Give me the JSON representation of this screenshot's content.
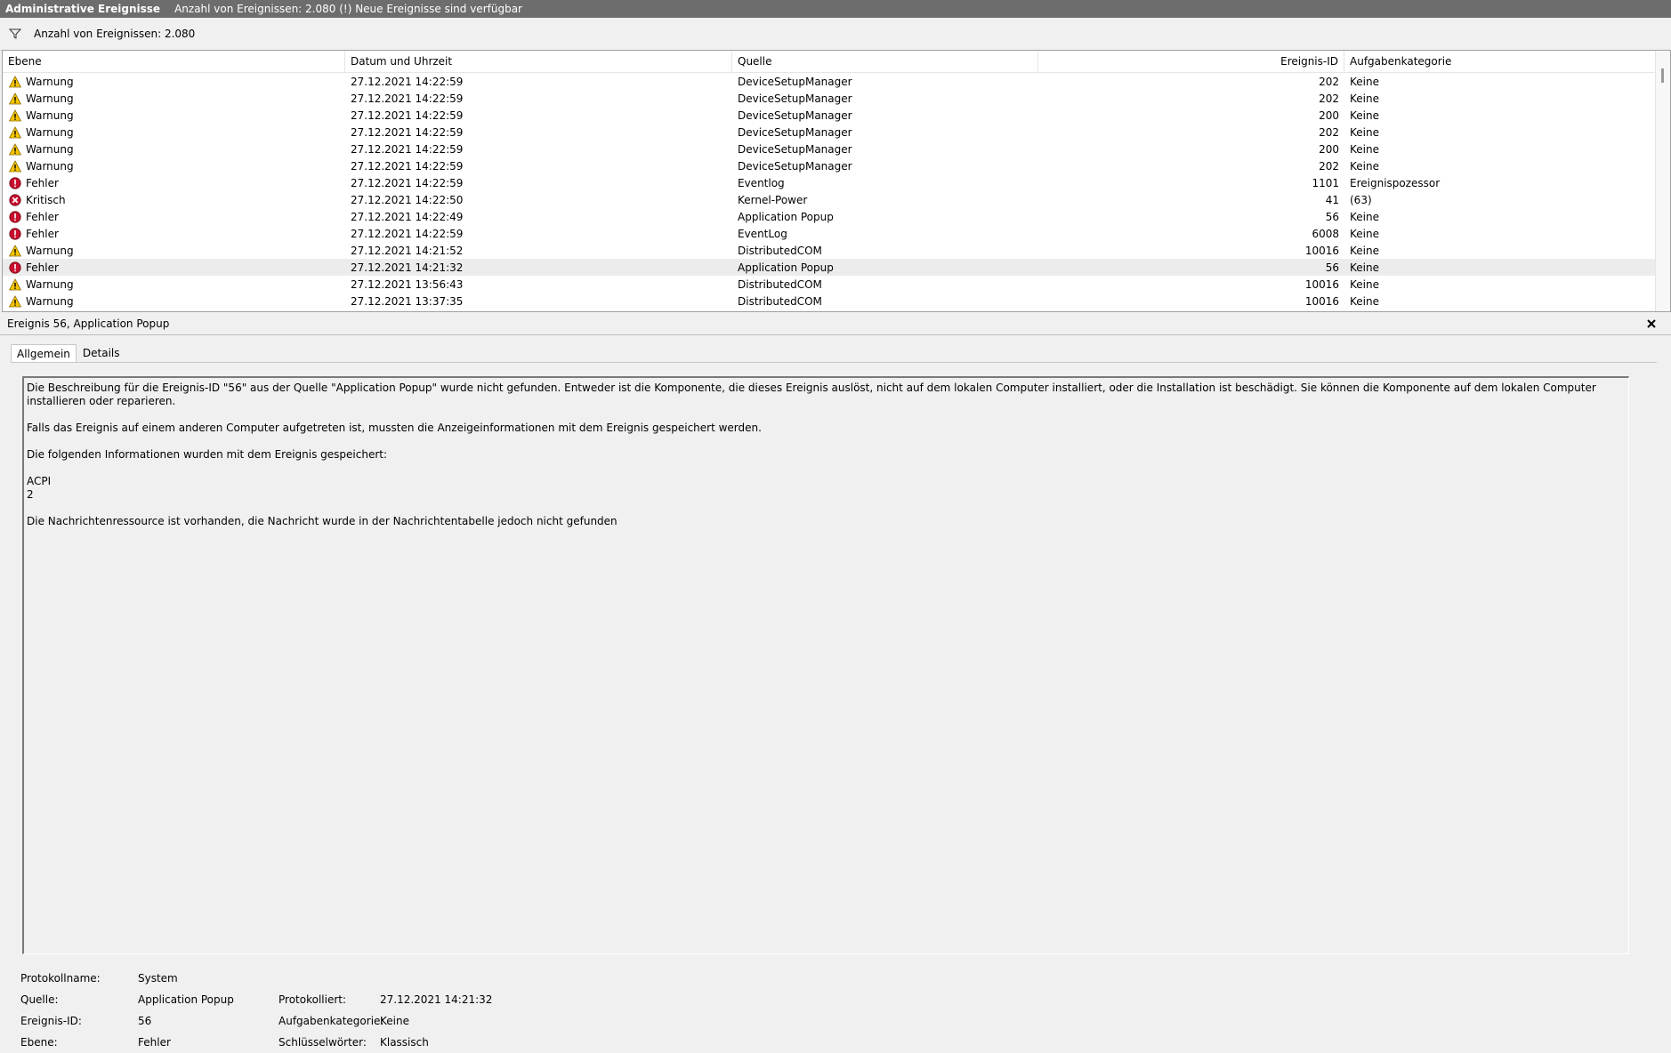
{
  "title_bar": {
    "title": "Administrative Ereignisse",
    "info": "Anzahl von Ereignissen: 2.080 (!) Neue Ereignisse sind verfügbar"
  },
  "filter_bar": {
    "count_text": "Anzahl von Ereignissen: 2.080"
  },
  "columns": {
    "level": "Ebene",
    "date": "Datum und Uhrzeit",
    "source": "Quelle",
    "event_id": "Ereignis-ID",
    "category": "Aufgabenkategorie"
  },
  "events": [
    {
      "level": "Warnung",
      "icon": "warning-icon",
      "date": "27.12.2021 14:22:59",
      "source": "DeviceSetupManager",
      "id": "202",
      "category": "Keine"
    },
    {
      "level": "Warnung",
      "icon": "warning-icon",
      "date": "27.12.2021 14:22:59",
      "source": "DeviceSetupManager",
      "id": "202",
      "category": "Keine"
    },
    {
      "level": "Warnung",
      "icon": "warning-icon",
      "date": "27.12.2021 14:22:59",
      "source": "DeviceSetupManager",
      "id": "200",
      "category": "Keine"
    },
    {
      "level": "Warnung",
      "icon": "warning-icon",
      "date": "27.12.2021 14:22:59",
      "source": "DeviceSetupManager",
      "id": "202",
      "category": "Keine"
    },
    {
      "level": "Warnung",
      "icon": "warning-icon",
      "date": "27.12.2021 14:22:59",
      "source": "DeviceSetupManager",
      "id": "200",
      "category": "Keine"
    },
    {
      "level": "Warnung",
      "icon": "warning-icon",
      "date": "27.12.2021 14:22:59",
      "source": "DeviceSetupManager",
      "id": "202",
      "category": "Keine"
    },
    {
      "level": "Fehler",
      "icon": "error-icon",
      "date": "27.12.2021 14:22:59",
      "source": "Eventlog",
      "id": "1101",
      "category": "Ereignispozessor"
    },
    {
      "level": "Kritisch",
      "icon": "critical-icon",
      "date": "27.12.2021 14:22:50",
      "source": "Kernel-Power",
      "id": "41",
      "category": "(63)"
    },
    {
      "level": "Fehler",
      "icon": "error-icon",
      "date": "27.12.2021 14:22:49",
      "source": "Application Popup",
      "id": "56",
      "category": "Keine"
    },
    {
      "level": "Fehler",
      "icon": "error-icon",
      "date": "27.12.2021 14:22:59",
      "source": "EventLog",
      "id": "6008",
      "category": "Keine"
    },
    {
      "level": "Warnung",
      "icon": "warning-icon",
      "date": "27.12.2021 14:21:52",
      "source": "DistributedCOM",
      "id": "10016",
      "category": "Keine"
    },
    {
      "level": "Fehler",
      "icon": "error-icon",
      "date": "27.12.2021 14:21:32",
      "source": "Application Popup",
      "id": "56",
      "category": "Keine",
      "selected": true
    },
    {
      "level": "Warnung",
      "icon": "warning-icon",
      "date": "27.12.2021 13:56:43",
      "source": "DistributedCOM",
      "id": "10016",
      "category": "Keine"
    },
    {
      "level": "Warnung",
      "icon": "warning-icon",
      "date": "27.12.2021 13:37:35",
      "source": "DistributedCOM",
      "id": "10016",
      "category": "Keine"
    }
  ],
  "detail": {
    "title": "Ereignis 56, Application Popup",
    "tabs": [
      "Allgemein",
      "Details"
    ],
    "description": [
      "Die Beschreibung für die Ereignis-ID \"56\" aus der Quelle \"Application Popup\" wurde nicht gefunden. Entweder ist die Komponente, die dieses Ereignis auslöst, nicht auf dem lokalen Computer installiert, oder die Installation ist beschädigt. Sie können die Komponente auf dem lokalen Computer installieren oder reparieren.",
      "Falls das Ereignis auf einem anderen Computer aufgetreten ist, mussten die Anzeigeinformationen mit dem Ereignis gespeichert werden.",
      "Die folgenden Informationen wurden mit dem Ereignis gespeichert:",
      "ACPI",
      "2",
      "Die Nachrichtenressource ist vorhanden, die Nachricht wurde in der Nachrichtentabelle jedoch nicht gefunden"
    ],
    "properties": {
      "log_name_label": "Protokollname:",
      "log_name": "System",
      "source_label": "Quelle:",
      "source": "Application Popup",
      "logged_label": "Protokolliert:",
      "logged": "27.12.2021 14:21:32",
      "event_id_label": "Ereignis-ID:",
      "event_id": "56",
      "category_label": "Aufgabenkategorie:",
      "category": "Keine",
      "level_label": "Ebene:",
      "level": "Fehler",
      "keywords_label": "Schlüsselwörter:",
      "keywords": "Klassisch"
    }
  },
  "colors": {
    "title_bar": "#6d6d6d",
    "selected_row": "#ececec",
    "warning": "#f5c400",
    "error": "#c8102e",
    "critical": "#c8102e"
  }
}
